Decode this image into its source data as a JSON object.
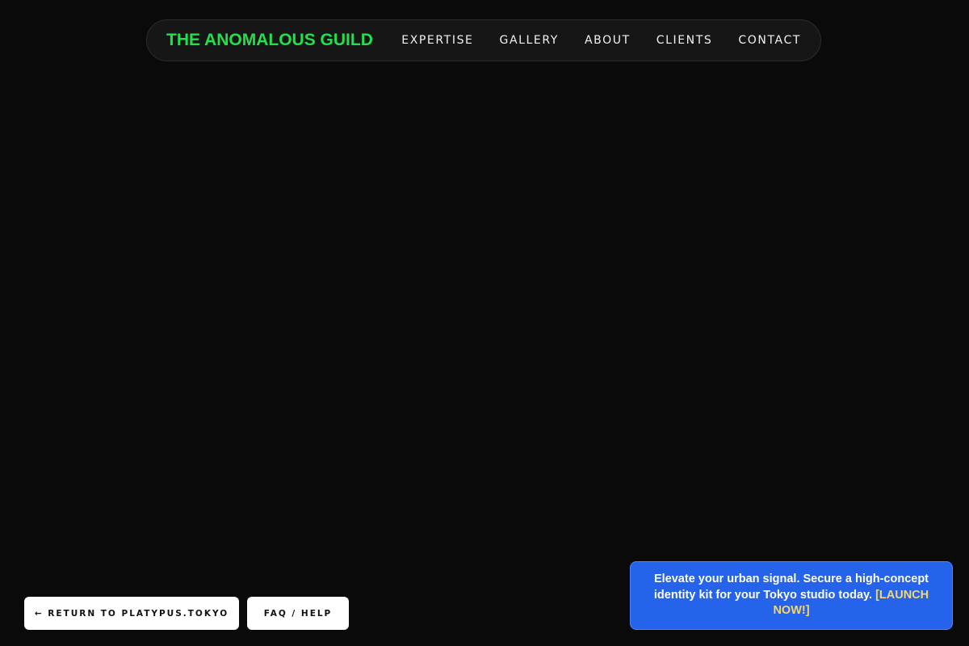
{
  "header": {
    "brand": "THE ANOMALOUS GUILD",
    "nav": [
      {
        "label": "EXPERTISE"
      },
      {
        "label": "GALLERY"
      },
      {
        "label": "ABOUT"
      },
      {
        "label": "CLIENTS"
      },
      {
        "label": "CONTACT"
      }
    ]
  },
  "footer_buttons": {
    "return_label": "← RETURN TO PLATYPUS.TOKYO",
    "faq_label": "FAQ / HELP"
  },
  "promo": {
    "message": "Elevate your urban signal. Secure a high-concept identity kit for your Tokyo studio today.",
    "cta": "[LAUNCH NOW!]"
  },
  "colors": {
    "background": "#0a0a0a",
    "brand": "#22e04a",
    "promo_bg": "#2563eb",
    "promo_cta": "#f5d76a"
  }
}
